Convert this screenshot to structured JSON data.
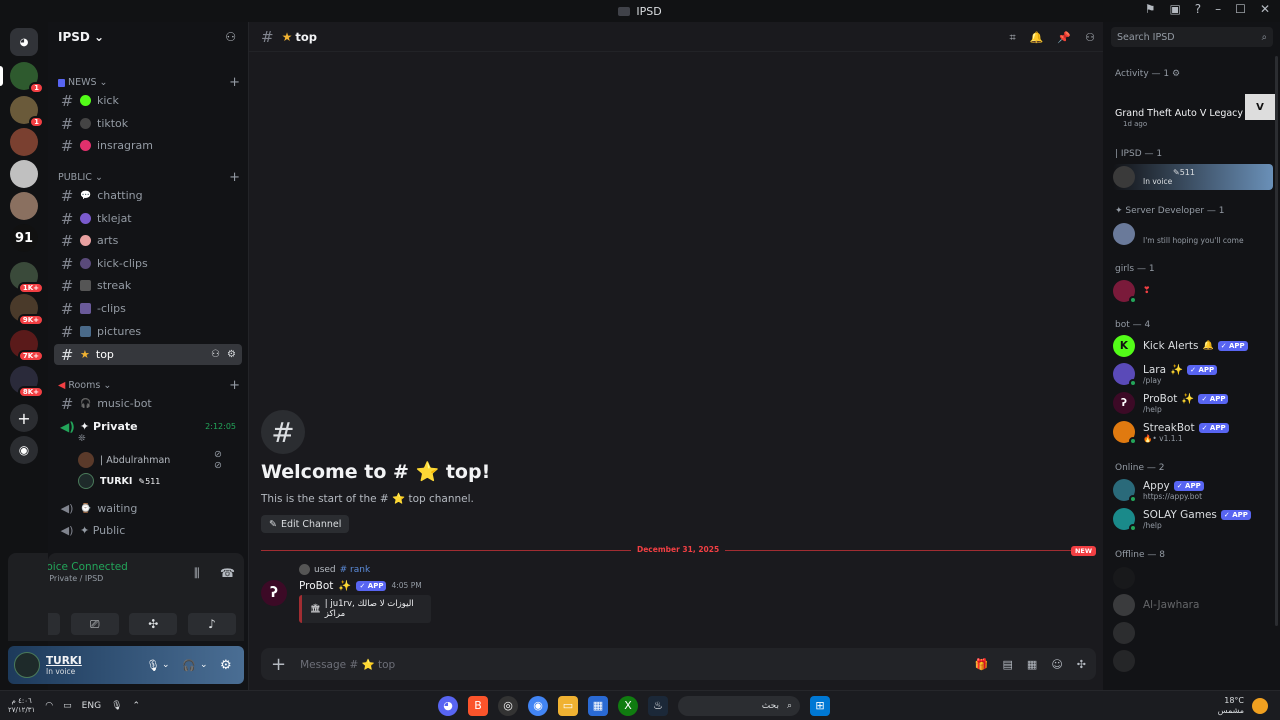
{
  "window": {
    "title": "IPSD"
  },
  "servers": {
    "badges": [
      "1",
      "1",
      "1K+",
      "9K+",
      "7K+",
      "8K+"
    ],
    "number_server": "91"
  },
  "guild": {
    "name": "IPSD"
  },
  "categories": {
    "news": "NEWS",
    "public": "PUBLIC",
    "rooms": "Rooms"
  },
  "channels": {
    "news": [
      "kick",
      "tiktok",
      "insragram"
    ],
    "public": [
      "chatting",
      "tklejat",
      "arts",
      "kick-clips",
      "streak",
      "-clips",
      "pictures",
      "top"
    ],
    "rooms": [
      "music-bot"
    ]
  },
  "voice": {
    "private_label": "✦ Private",
    "private_timer": "2:12:05",
    "user1": "| Abdulrahman",
    "user2": "TURKI",
    "user2_badge": "511",
    "waiting": "waiting",
    "public_label": "✦ Public"
  },
  "panel": {
    "status": "Voice Connected",
    "location": "✦ Private / IPSD"
  },
  "userbar": {
    "name": "TURKI",
    "status": "In voice"
  },
  "main": {
    "channel_name": "top",
    "welcome_title": "Welcome to # ⭐ top!",
    "welcome_sub": "This is the start of the # ⭐ top channel.",
    "edit_button": "Edit Channel",
    "divider_date": "December 31, 2025",
    "new_tag": "NEW",
    "reply_used": "used",
    "reply_command": "# rank",
    "author": "ProBot",
    "app_tag": "APP",
    "time": "4:05 PM",
    "embed_text": "| ju1rv, اليوزات لا صالك مراكز",
    "composer_placeholder": "Message # ⭐ top"
  },
  "members": {
    "search_placeholder": "Search IPSD",
    "activity_header": "Activity — 1",
    "activity_game": "Grand Theft Auto V Legacy",
    "activity_time": "1d ago",
    "ipsd_header": "| IPSD — 1",
    "ipsd_user_badge": "511",
    "ipsd_user_status": "In voice",
    "dev_header": "✦ Server Developer — 1",
    "dev_user_status": "I'm still hoping you'll come",
    "girls_header": "girls — 1",
    "bot_header": "bot — 4",
    "bots": [
      {
        "name": "Kick Alerts",
        "sub": ""
      },
      {
        "name": "Lara",
        "sub": "/play"
      },
      {
        "name": "ProBot",
        "sub": "/help"
      },
      {
        "name": "StreakBot",
        "sub": "• v1.1.1"
      }
    ],
    "online_header": "Online — 2",
    "online": [
      {
        "name": "Appy",
        "sub": "https://appy.bot"
      },
      {
        "name": "SOLAY Games",
        "sub": "/help"
      }
    ],
    "offline_header": "Offline — 8",
    "offline_name": "Al-Jawhara"
  },
  "taskbar": {
    "date_left": "٤:٠٦ م",
    "date_left2": "٢٧/١٢/٣١",
    "lang": "ENG",
    "search": "بحث",
    "temp": "18°C",
    "weather": "مشمس"
  },
  "colors": {
    "accent": "#5865f2",
    "danger": "#f23f43",
    "online": "#23a55a"
  }
}
